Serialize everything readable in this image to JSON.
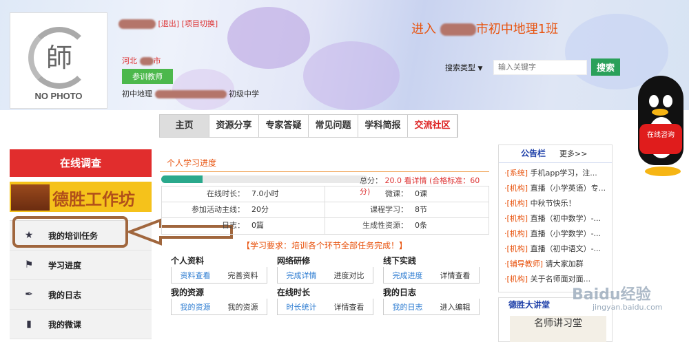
{
  "header": {
    "logout": "[退出]",
    "switch_project": "[项目切换]",
    "location": "河北",
    "location_suffix": "市",
    "role": "参训教师",
    "subject_prefix": "初中地理",
    "school_suffix": "初级中学",
    "enter_prefix": "进入",
    "enter_class": "市初中地理1班",
    "photo_text": "NO PHOTO",
    "photo_glyph": "師"
  },
  "search": {
    "type_label": "搜索类型",
    "placeholder": "输入关键字",
    "button": "搜索"
  },
  "nav": [
    "主页",
    "资源分享",
    "专家答疑",
    "常见问题",
    "学科简报",
    "交流社区"
  ],
  "sidebar": {
    "survey": "在线调查",
    "workshop": "德胜工作坊",
    "items": [
      {
        "label": "我的培训任务",
        "icon": "star-icon",
        "glyph": "★"
      },
      {
        "label": "学习进度",
        "icon": "flag-icon",
        "glyph": "⚑"
      },
      {
        "label": "我的日志",
        "icon": "pen-icon",
        "glyph": "✒"
      },
      {
        "label": "我的微课",
        "icon": "bar-chart-icon",
        "glyph": "▮"
      }
    ]
  },
  "progress": {
    "tab": "个人学习进度",
    "fraction": 0.2,
    "total_label": "总分：",
    "total": "20.0",
    "detail": "看详情",
    "standard": "(合格标准：60分)"
  },
  "stats": [
    [
      {
        "label": "在线时长：",
        "value": "7.0小时"
      },
      {
        "label": "微课：",
        "value": "0课"
      }
    ],
    [
      {
        "label": "参加活动主线：",
        "value": "20分"
      },
      {
        "label": "课程学习：",
        "value": "8节"
      }
    ],
    [
      {
        "label": "日志：",
        "value": "0篇"
      },
      {
        "label": "生成性资源：",
        "value": "0条"
      }
    ]
  ],
  "requirement": "【学习要求：培训各个环节全部任务完成！】",
  "boxes": [
    {
      "title": "个人资料",
      "a": "资料查看",
      "b": "完善资料"
    },
    {
      "title": "网络研修",
      "a": "完成详情",
      "b": "进度对比"
    },
    {
      "title": "线下实践",
      "a": "完成进度",
      "b": "详情查看"
    },
    {
      "title": "我的资源",
      "a": "我的资源",
      "b": "我的资源"
    },
    {
      "title": "在线时长",
      "a": "时长统计",
      "b": "详情查看"
    },
    {
      "title": "我的日志",
      "a": "我的日志",
      "b": "进入编辑"
    }
  ],
  "notice": {
    "title": "公告栏",
    "more": "更多>>",
    "items": [
      {
        "tag": "·[系统]",
        "text": " 手机app学习，注..."
      },
      {
        "tag": "·[机构]",
        "text": " 直播（小学英语）专..."
      },
      {
        "tag": "·[机构]",
        "text": " 中秋节快乐！"
      },
      {
        "tag": "·[机构]",
        "text": " 直播（初中数学）-..."
      },
      {
        "tag": "·[机构]",
        "text": " 直播（小学数学）-..."
      },
      {
        "tag": "·[机构]",
        "text": " 直播（初中语文）-..."
      },
      {
        "tag": "·[辅导教师]",
        "text": " 请大家加群"
      },
      {
        "tag": "·[机构]",
        "text": " 关于名师面对面..."
      }
    ]
  },
  "dsd": {
    "title": "德胜大讲堂",
    "image_text": "名师讲习堂"
  },
  "qq": {
    "label": "在线咨询"
  },
  "watermark": {
    "brand": "Baidu经验",
    "url": "jingyan.baidu.com"
  },
  "colors": {
    "accent": "#e8530e",
    "red": "#e12d2d",
    "green": "#2aa05a",
    "blue": "#2b7bd1"
  }
}
